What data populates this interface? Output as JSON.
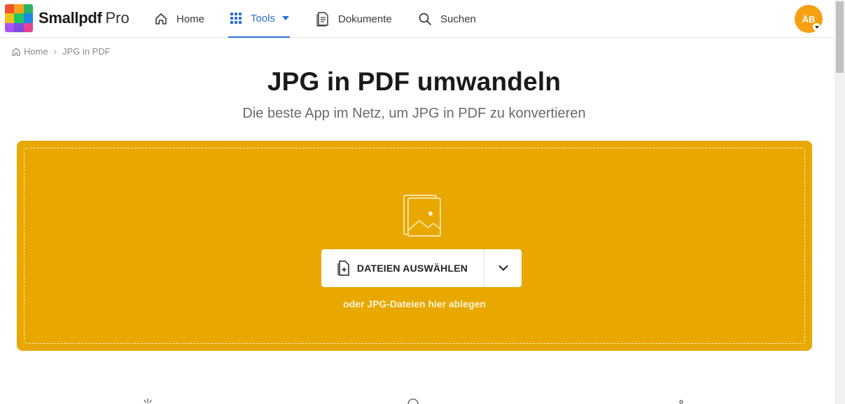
{
  "header": {
    "brand": "Smallpdf",
    "brand_tier": "Pro",
    "nav": {
      "home": "Home",
      "tools": "Tools",
      "documents": "Dokumente",
      "search": "Suchen"
    },
    "avatar_initials": "ÄB"
  },
  "breadcrumb": {
    "home": "Home",
    "separator": "›",
    "current": "JPG in PDF"
  },
  "hero": {
    "title": "JPG in PDF umwandeln",
    "subtitle": "Die beste App im Netz, um JPG in PDF zu konvertieren"
  },
  "dropzone": {
    "choose_button": "DATEIEN AUSWÄHLEN",
    "hint": "oder JPG-Dateien hier ablegen",
    "color": "#e8a800"
  },
  "logo_colors": [
    "#f03e2f",
    "#f7a21b",
    "#2fb344",
    "#1a73e8",
    "#ffcc00",
    "#34a853",
    "#9b51e0",
    "#8e44ad",
    "#e84393"
  ],
  "accent": "#2b6fd6"
}
